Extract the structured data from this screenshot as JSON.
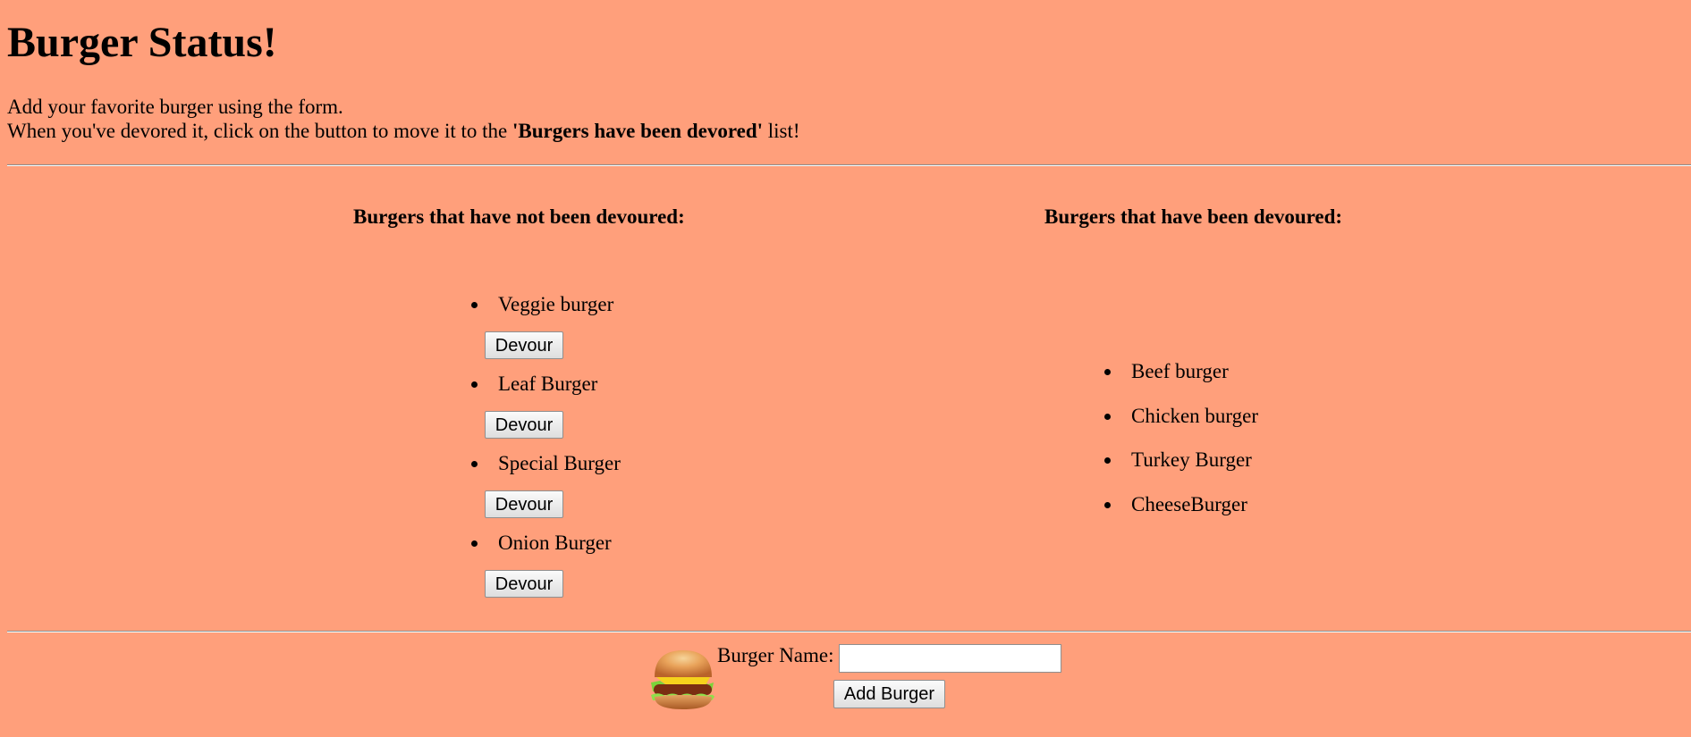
{
  "header": {
    "title": "Burger Status!",
    "intro_line1": "Add your favorite burger using the form.",
    "intro_line2_pre": "When you've devored it, click on the button to move it to the ",
    "intro_line2_bold": "'Burgers have been devored'",
    "intro_line2_post": " list!"
  },
  "not_devoured": {
    "heading": "Burgers that have not been devoured:",
    "button_label": "Devour",
    "items": [
      "Veggie burger",
      "Leaf Burger",
      "Special Burger",
      "Onion Burger"
    ]
  },
  "devoured": {
    "heading": "Burgers that have been devoured:",
    "items": [
      "Beef burger",
      "Chicken burger",
      "Turkey Burger",
      "CheeseBurger"
    ]
  },
  "form": {
    "label": "Burger Name:",
    "input_value": "",
    "submit_label": "Add Burger"
  },
  "icons": {
    "burger": "burger-icon"
  },
  "colors": {
    "background": "#ff9f7b"
  }
}
